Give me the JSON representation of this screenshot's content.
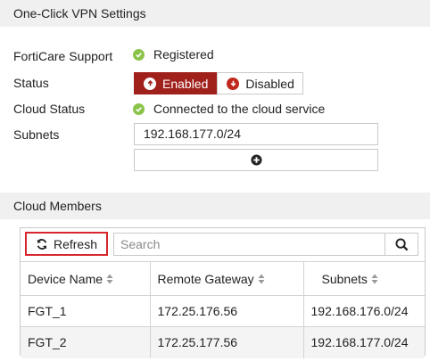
{
  "vpn_section": {
    "title": "One-Click VPN Settings",
    "forticare_label": "FortiCare Support",
    "forticare_value": "Registered",
    "status_label": "Status",
    "status_enabled": "Enabled",
    "status_disabled": "Disabled",
    "cloud_status_label": "Cloud Status",
    "cloud_status_value": "Connected to the cloud service",
    "subnets_label": "Subnets",
    "subnets_value": "192.168.177.0/24"
  },
  "members_section": {
    "title": "Cloud Members",
    "refresh_label": "Refresh",
    "search_placeholder": "Search",
    "columns": [
      "Device Name",
      "Remote Gateway",
      "Subnets"
    ],
    "rows": [
      [
        "FGT_1",
        "172.25.176.56",
        "192.168.176.0/24"
      ],
      [
        "FGT_2",
        "172.25.177.56",
        "192.168.177.0/24"
      ]
    ]
  },
  "colors": {
    "accent": "#a0201c",
    "success": "#8bc34a",
    "highlight_border": "#d7262e",
    "section_bg": "#f0f0f0"
  },
  "icons": [
    "check-icon",
    "arrow-up-circle-icon",
    "arrow-down-circle-icon",
    "plus-circle-icon",
    "refresh-icon",
    "search-icon",
    "sort-icon"
  ]
}
